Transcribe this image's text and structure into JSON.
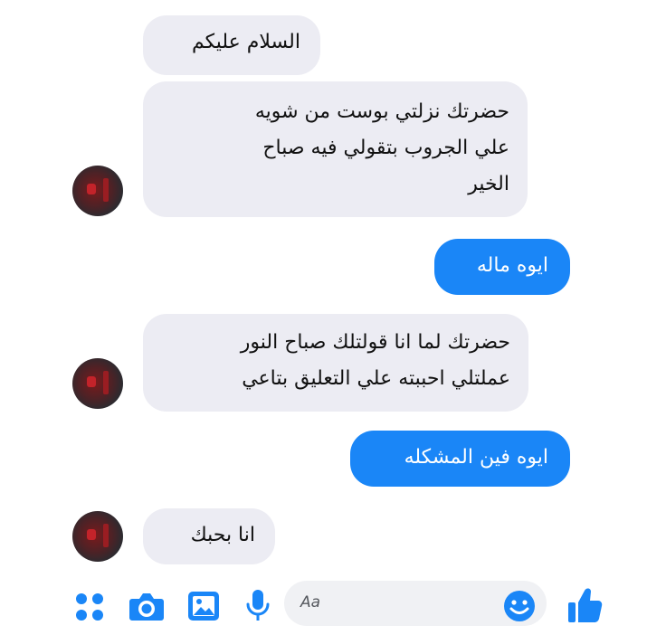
{
  "messages": [
    {
      "direction": "incoming",
      "text": "السلام عليكم"
    },
    {
      "direction": "incoming",
      "text": "حضرتك نزلتي بوست من شويه\nعلي الجروب بتقولي فيه صباح\nالخير"
    },
    {
      "direction": "outgoing",
      "text": "ايوه ماله"
    },
    {
      "direction": "incoming",
      "text": "حضرتك لما انا قولتلك صباح النور\nعملتلي احببته علي التعليق بتاعي"
    },
    {
      "direction": "outgoing",
      "text": "ايوه فين المشكله"
    },
    {
      "direction": "incoming",
      "text": "انا بحبك"
    }
  ],
  "composer": {
    "placeholder": "Aa",
    "icons": [
      "apps-grid-icon",
      "camera-icon",
      "gallery-icon",
      "microphone-icon",
      "emoji-icon",
      "thumbs-up-icon"
    ]
  },
  "colors": {
    "accent": "#1a86f7",
    "incoming_bubble": "#ececf3",
    "outgoing_text": "#ffffff"
  }
}
